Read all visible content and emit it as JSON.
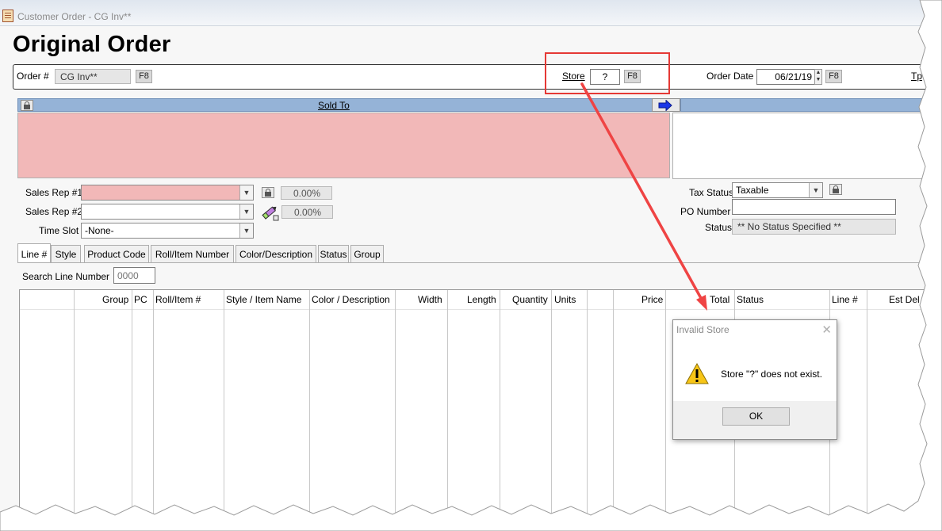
{
  "window": {
    "title": "Customer Order - CG Inv**"
  },
  "page": {
    "heading": "Original Order"
  },
  "order_bar": {
    "order_label": "Order #",
    "order_value": "CG Inv**",
    "order_key": "F8",
    "store_label": "Store",
    "store_value": "?",
    "store_key": "F8",
    "order_date_label": "Order Date",
    "order_date_value": "06/21/19",
    "order_date_key": "F8",
    "truncated_label": "Tp"
  },
  "sold_to": {
    "header": "Sold To"
  },
  "sales": {
    "rep1_label": "Sales Rep #1",
    "rep1_value": "",
    "rep1_pct": "0.00%",
    "rep2_label": "Sales Rep #2",
    "rep2_value": "",
    "rep2_pct": "0.00%",
    "timeslot_label": "Time Slot",
    "timeslot_value": "-None-"
  },
  "tax": {
    "tax_status_label": "Tax Status",
    "tax_status_value": "Taxable",
    "po_label": "PO Number",
    "po_value": "",
    "status_label": "Status",
    "status_value": "** No Status Specified **"
  },
  "tabs": [
    "Line #",
    "Style",
    "Product Code",
    "Roll/Item Number",
    "Color/Description",
    "Status",
    "Group"
  ],
  "search": {
    "label": "Search Line Number",
    "placeholder": "0000"
  },
  "grid": {
    "columns": [
      "Group",
      "PC",
      "Roll/Item #",
      "Style / Item Name",
      "Color / Description",
      "Width",
      "Length",
      "Quantity",
      "Units",
      "",
      "Price",
      "Total",
      "Status",
      "Line #",
      "Est Del"
    ]
  },
  "dialog": {
    "title": "Invalid Store",
    "message": "Store \"?\" does not exist.",
    "ok_label": "OK",
    "icon": "warning-icon"
  },
  "colors": {
    "highlight": "#e53935",
    "header_blue": "#95b3d7",
    "required_pink": "#f2b8b8"
  }
}
